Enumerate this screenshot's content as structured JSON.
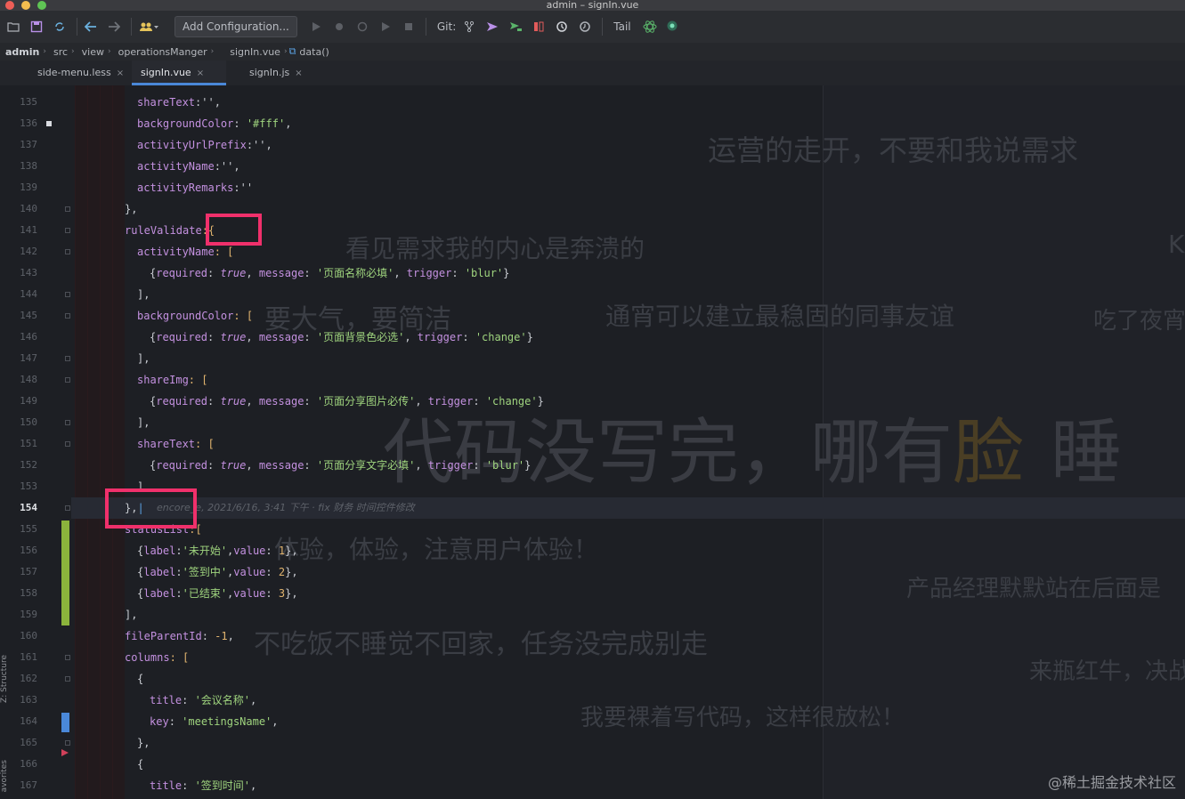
{
  "window": {
    "title": "admin – signIn.vue"
  },
  "toolbar": {
    "config_button": "Add Configuration...",
    "git_label": "Git:",
    "tail_label": "Tail"
  },
  "breadcrumb": {
    "items": [
      "admin",
      "src",
      "view",
      "operationsManger",
      "signIn.vue",
      "data()"
    ]
  },
  "tabs": [
    {
      "label": "side-menu.less",
      "close": "×"
    },
    {
      "label": "signIn.vue",
      "close": "×"
    },
    {
      "label": "signIn.js",
      "close": "×"
    }
  ],
  "lines": {
    "135": "135",
    "136": "136",
    "137": "137",
    "138": "138",
    "139": "139",
    "140": "140",
    "141": "141",
    "142": "142",
    "143": "143",
    "144": "144",
    "145": "145",
    "146": "146",
    "147": "147",
    "148": "148",
    "149": "149",
    "150": "150",
    "151": "151",
    "152": "152",
    "153": "153",
    "154": "154",
    "155": "155",
    "156": "156",
    "157": "157",
    "158": "158",
    "159": "159",
    "160": "160",
    "161": "161",
    "162": "162",
    "163": "163",
    "164": "164",
    "165": "165",
    "166": "166",
    "167": "167"
  },
  "code": {
    "l135_key": "shareText",
    "l135_rest": ":'',",
    "l136_key": "backgroundColor",
    "l136_val": "'#fff'",
    "l137_key": "activityUrlPrefix",
    "l137_rest": ":'',",
    "l138_key": "activityName",
    "l138_rest": ":'',",
    "l139_key": "activityRemarks",
    "l139_rest": ":''",
    "l140": "},",
    "l141_key": "ruleValidate",
    "l141_rest": ":{",
    "l142_key": "activityName",
    "l142_rest": ": [",
    "l143_msg": "'页面名称必填'",
    "l143_trig": "'blur'",
    "l144": "],",
    "l145_key": "backgroundColor",
    "l145_rest": ": [",
    "l146_msg": "'页面背景色必选'",
    "l146_trig": "'change'",
    "l147": "],",
    "l148_key": "shareImg",
    "l148_rest": ": [",
    "l149_msg": "'页面分享图片必传'",
    "l149_trig": "'change'",
    "l150": "],",
    "l151_key": "shareText",
    "l151_rest": ": [",
    "l152_msg": "'页面分享文字必填'",
    "l152_trig": "'blur'",
    "l153": "]",
    "l154": "},",
    "l155_key": "statusList",
    "l155_rest": ":[",
    "l156_label": "'未开始'",
    "l156_value": "1",
    "l157_label": "'签到中'",
    "l157_value": "2",
    "l158_label": "'已结束'",
    "l158_value": "3",
    "l159": "],",
    "l160_key": "fileParentId",
    "l160_val": "-1",
    "l161_key": "columns",
    "l161_rest": ": [",
    "l162": "{",
    "l163_val": "'会议名称'",
    "l164_val": "'meetingsName'",
    "l165": "},",
    "l166": "{",
    "l167_val": "'签到时间'",
    "kw_required": "required",
    "kw_true": "true",
    "kw_message": "message",
    "kw_trigger": "trigger",
    "kw_label": "label",
    "kw_value": "value",
    "kw_title": "title",
    "kw_key": "key"
  },
  "blame": "encore_e, 2021/6/16, 3:41 下午 · fix 财务 时间控件修改",
  "watermarks": {
    "w1": "运营的走开，不要和我说需求",
    "w2": "看见需求我的内心是奔溃的",
    "w3": "要大气，要简洁",
    "w4": "通宵可以建立最稳固的同事友谊",
    "w5": "吃了夜宵",
    "w6": "代码没写完，哪有",
    "w6b": "脸",
    "w6c": "睡",
    "w7": "体验，体验，注意用户体验！",
    "w8": "产品经理默默站在后面是",
    "w9": "不吃饭不睡觉不回家，任务没完成别走",
    "w10": "来瓶红牛，决战",
    "w11": "我要裸着写代码，这样很放松！",
    "w12": "K"
  },
  "side_tools": {
    "structure": "Z: Structure",
    "favorites": "avorites"
  },
  "footer_watermark": "@稀土掘金技术社区",
  "colors": {
    "accent": "#4a88d8",
    "highlight_box": "#f0306b",
    "vcs_added": "#8bb33c",
    "vcs_modified": "#4a88d8"
  }
}
